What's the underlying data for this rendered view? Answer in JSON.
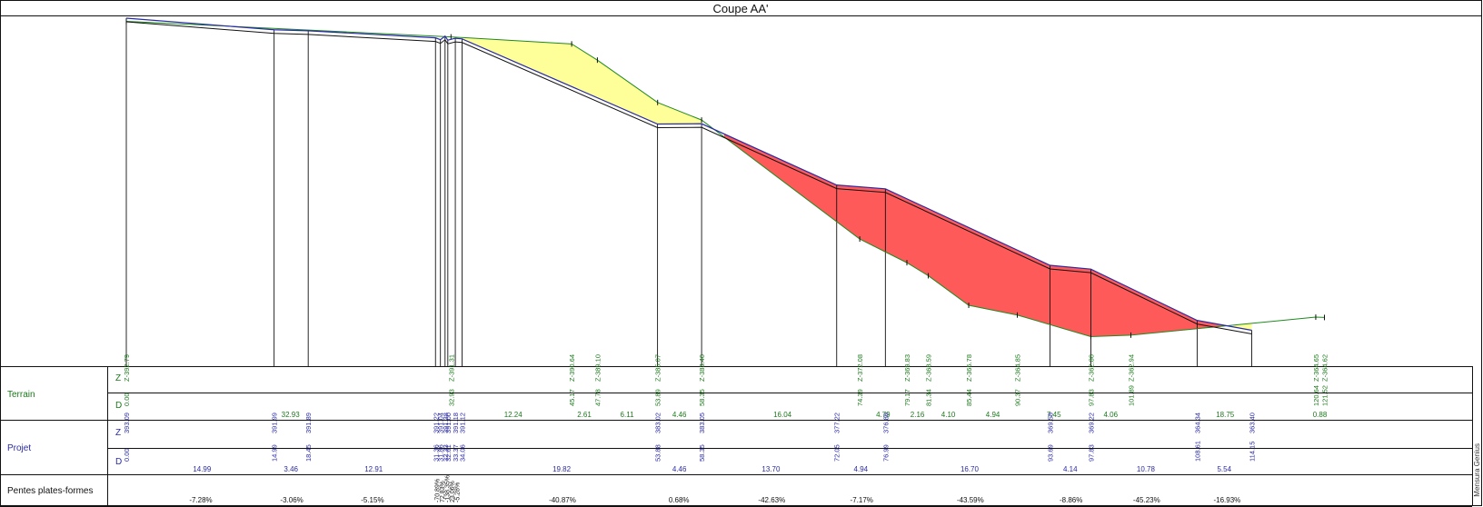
{
  "chart_data": {
    "type": "cross-section",
    "title": "Coupe AA'",
    "colors": {
      "terrain": "#1e8a1e",
      "projet": "#2a2aa8",
      "deblai": "#ffff99",
      "remblai": "#ff5a5a",
      "grid": "#111111"
    },
    "rows": {
      "terrain_label": "Terrain",
      "projet_label": "Projet",
      "pentes_label": "Pentes plates-formes",
      "z": "Z",
      "d": "D"
    },
    "watermark": "Mensura Genius",
    "terrain_points": [
      {
        "d": 0.0,
        "z": 392.79
      },
      {
        "d": 32.93,
        "z": 391.31
      },
      {
        "d": 45.17,
        "z": 390.64
      },
      {
        "d": 47.78,
        "z": 389.1
      },
      {
        "d": 53.89,
        "z": 385.07
      },
      {
        "d": 58.35,
        "z": 383.4
      },
      {
        "d": 74.39,
        "z": 372.08
      },
      {
        "d": 79.17,
        "z": 369.83
      },
      {
        "d": 81.34,
        "z": 368.59
      },
      {
        "d": 85.44,
        "z": 365.78
      },
      {
        "d": 90.37,
        "z": 364.85
      },
      {
        "d": 97.83,
        "z": 362.8
      },
      {
        "d": 101.89,
        "z": 362.94
      },
      {
        "d": 120.64,
        "z": 364.65
      },
      {
        "d": 121.52,
        "z": 364.62
      }
    ],
    "terrain_distances": [
      "32.93",
      "12.24",
      "2.61",
      "6.11",
      "4.46",
      "16.04",
      "4.79",
      "2.16",
      "4.10",
      "4.94",
      "7.45",
      "4.06",
      "18.75",
      "0.88"
    ],
    "projet_points": [
      {
        "d": 0.0,
        "z": 393.09
      },
      {
        "d": 14.99,
        "z": 391.99
      },
      {
        "d": 18.45,
        "z": 391.89
      },
      {
        "d": 31.36,
        "z": 391.22
      },
      {
        "d": 31.86,
        "z": 391.04
      },
      {
        "d": 32.33,
        "z": 391.38
      },
      {
        "d": 32.61,
        "z": 391.0
      },
      {
        "d": 33.37,
        "z": 391.18
      },
      {
        "d": 34.06,
        "z": 391.12
      },
      {
        "d": 53.88,
        "z": 383.02
      },
      {
        "d": 58.35,
        "z": 383.05
      },
      {
        "d": 72.05,
        "z": 377.22
      },
      {
        "d": 76.99,
        "z": 376.86
      },
      {
        "d": 93.69,
        "z": 369.58
      },
      {
        "d": 97.83,
        "z": 369.22
      },
      {
        "d": 108.61,
        "z": 364.34
      },
      {
        "d": 114.15,
        "z": 363.4
      }
    ],
    "projet_z_labels": [
      "393.09",
      "391.99",
      "391.89",
      "391.22",
      "391.04",
      "391.38",
      "391.00",
      "391.18",
      "391.12",
      "383.02",
      "383.05",
      "377.22",
      "376.86",
      "369.58",
      "369.22",
      "364.34",
      "363.40"
    ],
    "projet_d_labels": [
      "0.00",
      "14.99",
      "18.45",
      "31.36",
      "31.86",
      "32.33",
      "32.61",
      "33.37",
      "34.06",
      "53.88",
      "58.35",
      "72.05",
      "76.99",
      "93.69",
      "97.83",
      "108.61",
      "114.15"
    ],
    "projet_distances": [
      "14.99",
      "3.46",
      "12.91",
      "19.82",
      "4.46",
      "13.70",
      "4.94",
      "16.70",
      "4.14",
      "10.78",
      "5.54"
    ],
    "pentes": [
      "-7.28%",
      "-3.06%",
      "-5.15%",
      "-40.87%",
      "0.68%",
      "-42.63%",
      "-7.17%",
      "-43.59%",
      "-8.86%",
      "-45.23%",
      "-16.93%"
    ],
    "pentes_cluster": [
      "-70.89%",
      "72.83%",
      "-138.35%",
      "23.06%",
      "-5.28%"
    ]
  }
}
